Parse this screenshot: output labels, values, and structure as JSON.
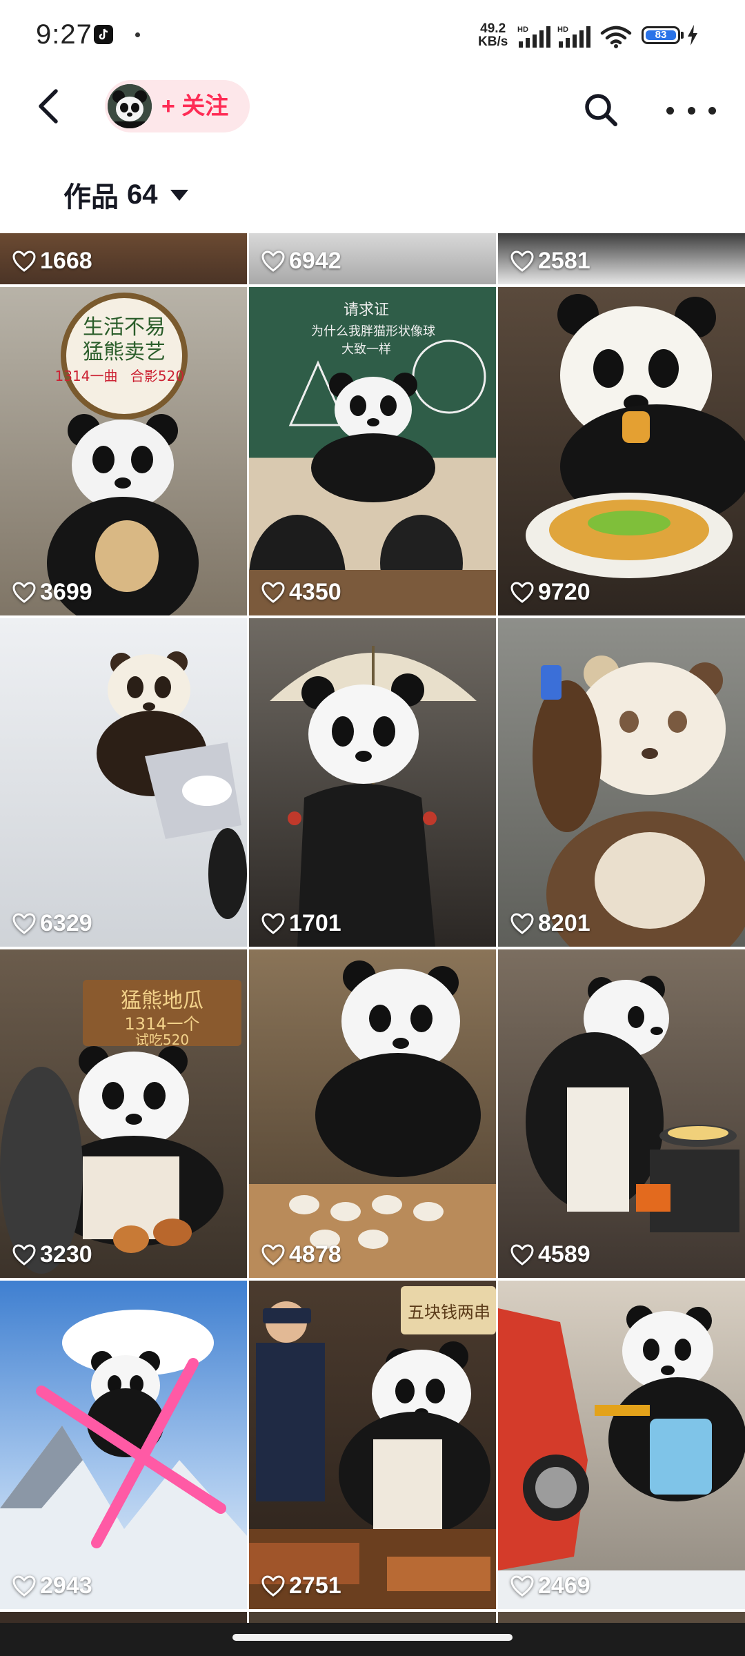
{
  "status_bar": {
    "time": "9:27",
    "net_speed_value": "49.2",
    "net_speed_unit": "KB/s",
    "sim1_label": "HD",
    "sim2_label": "HD",
    "battery": "83"
  },
  "top_nav": {
    "follow_label": "+ 关注"
  },
  "works": {
    "label": "作品",
    "count": "64"
  },
  "colors": {
    "accent": "#fe2c55",
    "follow_bg": "#fde7ea"
  },
  "tiles": [
    {
      "likes": "1668"
    },
    {
      "likes": "6942"
    },
    {
      "likes": "2581"
    },
    {
      "likes": "3699",
      "sign_line1": "生活不易",
      "sign_line2": "猛熊卖艺",
      "sign_line3": "1314一曲",
      "sign_line4": "合影520"
    },
    {
      "likes": "4350",
      "board_line1": "请求证",
      "board_line2": "为什么我胖猫形状像球",
      "board_line3": "大致一样"
    },
    {
      "likes": "9720"
    },
    {
      "likes": "6329"
    },
    {
      "likes": "1701"
    },
    {
      "likes": "8201"
    },
    {
      "likes": "3230",
      "sign_line1": "猛熊地瓜",
      "sign_line2": "1314一个",
      "sign_line3": "试吃520"
    },
    {
      "likes": "4878"
    },
    {
      "likes": "4589"
    },
    {
      "likes": "2943"
    },
    {
      "likes": "2751",
      "sign_line1": "五块钱两串"
    },
    {
      "likes": "2469"
    }
  ]
}
